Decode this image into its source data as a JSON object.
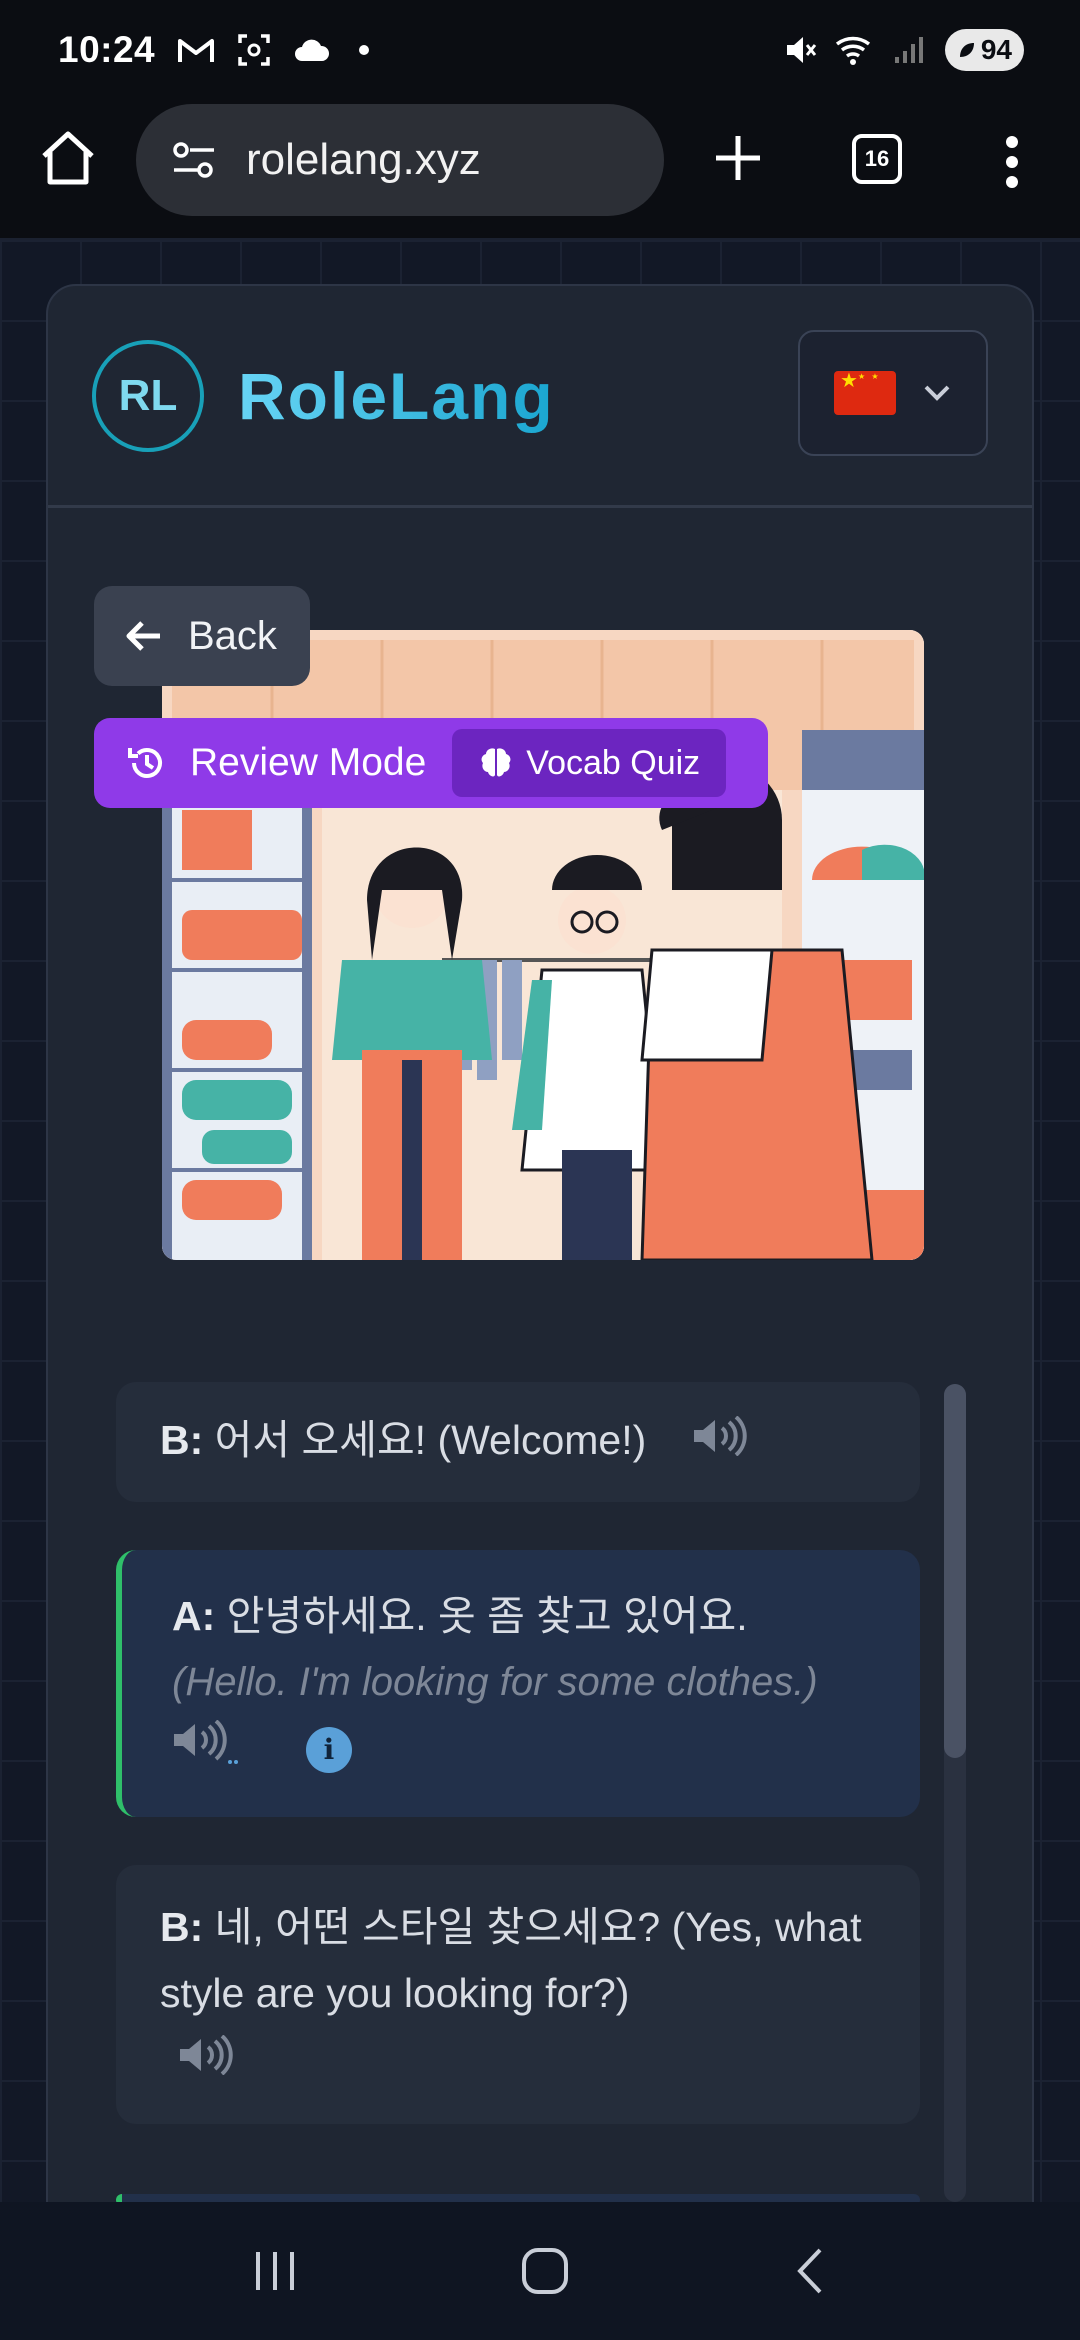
{
  "status_bar": {
    "time": "10:24",
    "battery": "94"
  },
  "browser": {
    "url": "rolelang.xyz",
    "tab_count": "16"
  },
  "app": {
    "logo_initials": "RL",
    "brand_name": "RoleLang",
    "language_flag": "china-flag"
  },
  "controls": {
    "back_label": "Back",
    "review_mode_label": "Review Mode",
    "vocab_quiz_label": "Vocab Quiz"
  },
  "dialogue": [
    {
      "speaker": "B:",
      "text": "어서 오세요! (Welcome!)"
    },
    {
      "speaker": "A:",
      "text": "안녕하세요. 옷 좀 찾고 있어요.",
      "translation": "(Hello. I'm looking for some clothes.)"
    },
    {
      "speaker": "B:",
      "text": "네, 어떤 스타일 찾으세요? (Yes, what style are you looking for?)"
    }
  ],
  "colors": {
    "review_mode": "#8f3ae8",
    "brand_gradient_start": "#67d4f5",
    "brand_gradient_end": "#1aa6d0",
    "active_line_accent": "#2fbf6a"
  }
}
